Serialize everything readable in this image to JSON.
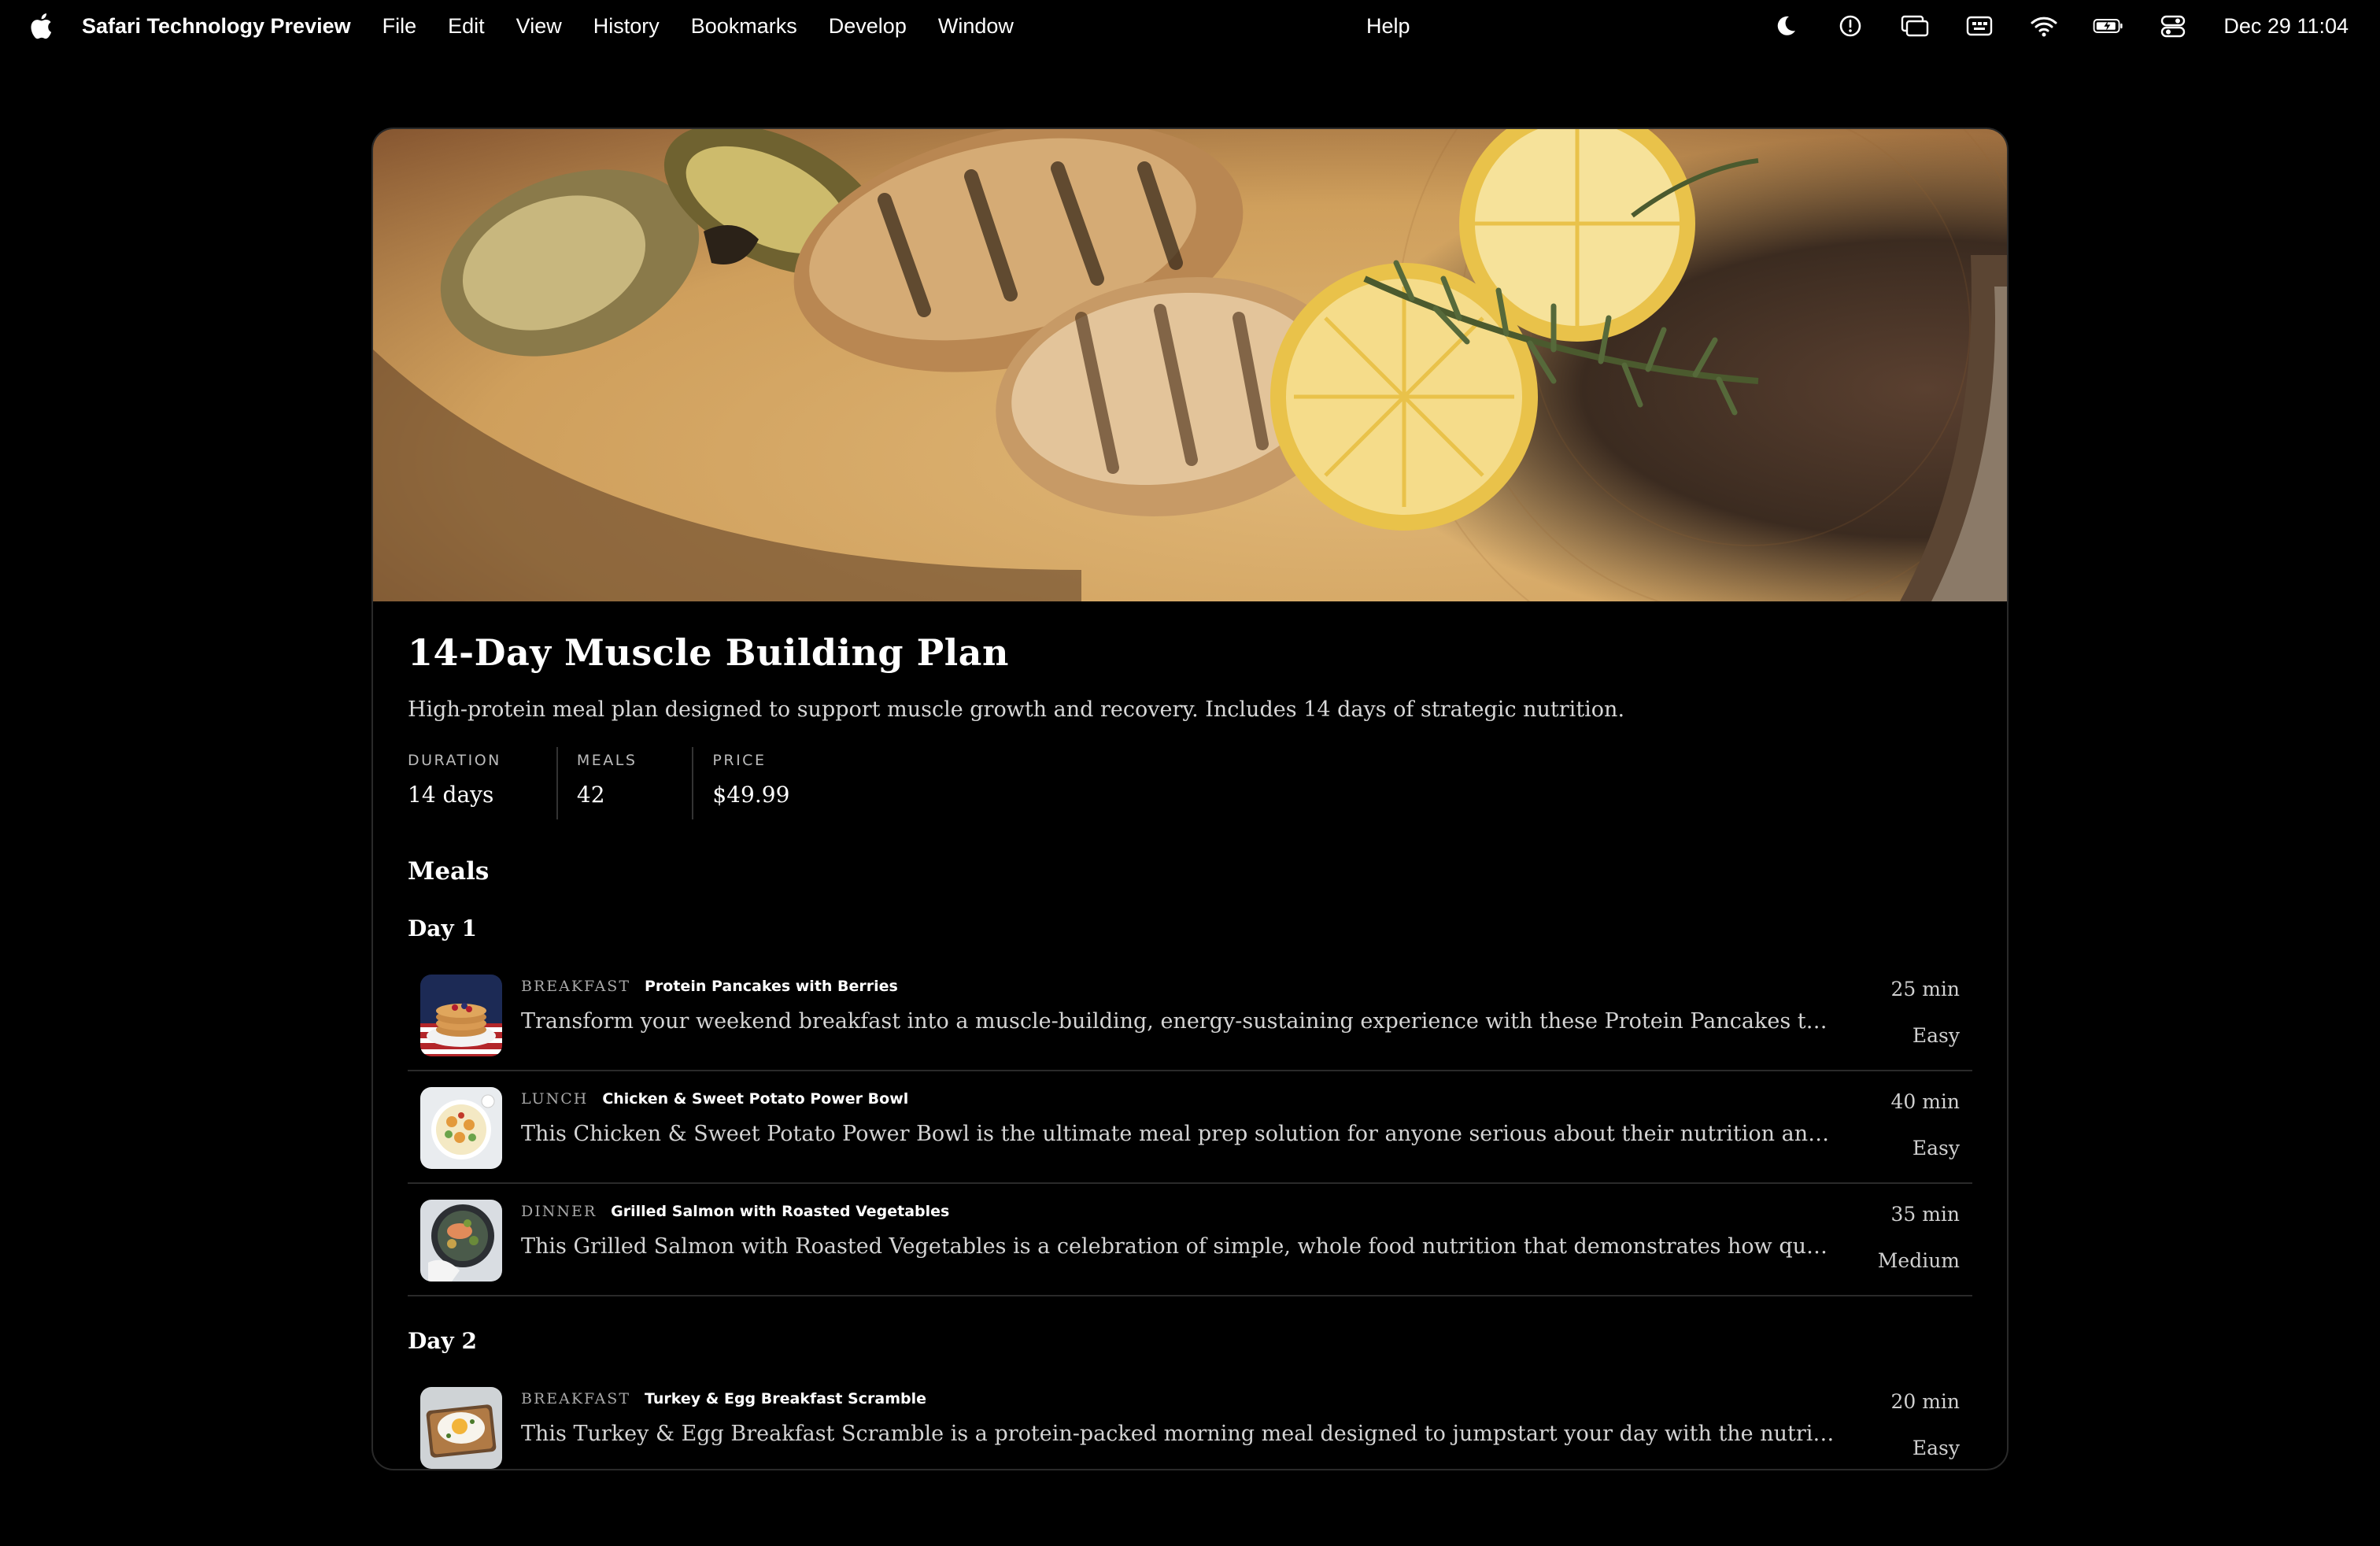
{
  "menubar": {
    "app_name": "Safari Technology Preview",
    "menus": [
      "File",
      "Edit",
      "View",
      "History",
      "Bookmarks",
      "Develop",
      "Window"
    ],
    "help": "Help",
    "status_icons": [
      "moon-icon",
      "screen-time-icon",
      "screen-mirroring-icon",
      "keyboard-icon",
      "wifi-icon",
      "battery-icon",
      "control-center-icon"
    ],
    "clock": "Dec 29  11:04"
  },
  "plan": {
    "title": "14-Day Muscle Building Plan",
    "description": "High-protein meal plan designed to support muscle growth and recovery. Includes 14 days of strategic nutrition.",
    "stats": [
      {
        "label": "DURATION",
        "value": "14 days"
      },
      {
        "label": "MEALS",
        "value": "42"
      },
      {
        "label": "PRICE",
        "value": "$49.99"
      }
    ]
  },
  "meals_section": {
    "title": "Meals",
    "days": [
      {
        "title": "Day 1",
        "meals": [
          {
            "type": "BREAKFAST",
            "name": "Protein Pancakes with Berries",
            "description": "Transform your weekend breakfast into a muscle-building, energy-sustaining experience with these Protein Pancakes that taste like an...",
            "time": "25 min",
            "difficulty": "Easy"
          },
          {
            "type": "LUNCH",
            "name": "Chicken & Sweet Potato Power Bowl",
            "description": "This Chicken & Sweet Potato Power Bowl is the ultimate meal prep solution for anyone serious about their nutrition and fitness goals....",
            "time": "40 min",
            "difficulty": "Easy"
          },
          {
            "type": "DINNER",
            "name": "Grilled Salmon with Roasted Vegetables",
            "description": "This Grilled Salmon with Roasted Vegetables is a celebration of simple, whole food nutrition that demonstrates how quality ingredients...",
            "time": "35 min",
            "difficulty": "Medium"
          }
        ]
      },
      {
        "title": "Day 2",
        "meals": [
          {
            "type": "BREAKFAST",
            "name": "Turkey & Egg Breakfast Scramble",
            "description": "This Turkey & Egg Breakfast Scramble is a protein-packed morning meal designed to jumpstart your day with the nutrients your body need...",
            "time": "20 min",
            "difficulty": "Easy"
          }
        ]
      }
    ]
  }
}
